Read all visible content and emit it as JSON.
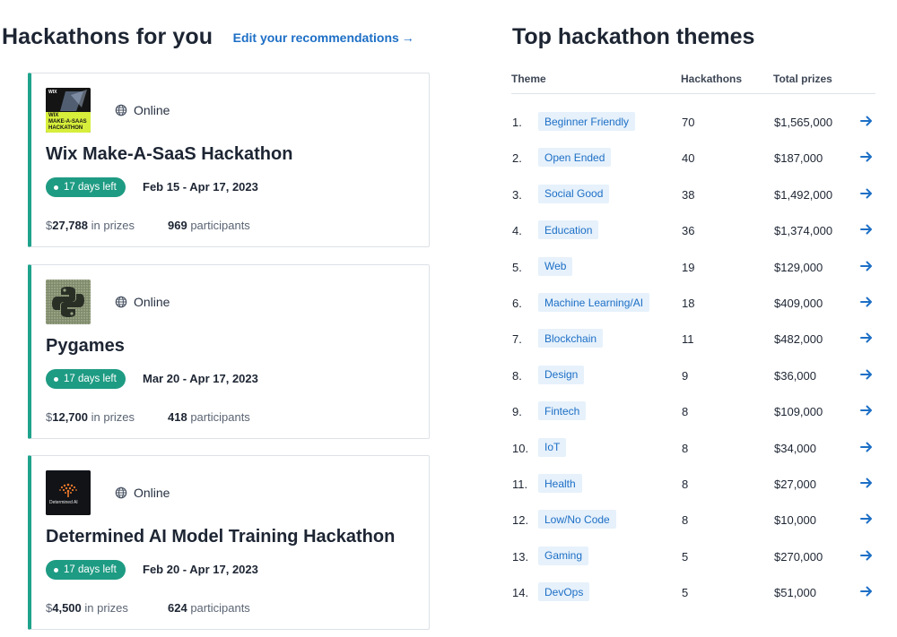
{
  "left": {
    "title": "Hackathons for you",
    "edit_link": "Edit your recommendations"
  },
  "hackathons": [
    {
      "name": "Wix Make-A-SaaS Hackathon",
      "location": "Online",
      "badge": "17 days left",
      "dates": "Feb 15 - Apr 17, 2023",
      "prize_amount": "27,788",
      "prize_suffix": "in prizes",
      "participants": "969",
      "participants_suffix": "participants",
      "thumb_lines": [
        "WIX",
        "MAKE-A-SAAS",
        "HACKATHON"
      ],
      "thumb_brand": "WIX"
    },
    {
      "name": "Pygames",
      "location": "Online",
      "badge": "17 days left",
      "dates": "Mar 20 - Apr 17, 2023",
      "prize_amount": "12,700",
      "prize_suffix": "in prizes",
      "participants": "418",
      "participants_suffix": "participants"
    },
    {
      "name": "Determined AI Model Training Hackathon",
      "location": "Online",
      "badge": "17 days left",
      "dates": "Feb 20 - Apr 17, 2023",
      "prize_amount": "4,500",
      "prize_suffix": "in prizes",
      "participants": "624",
      "participants_suffix": "participants",
      "thumb_text": "Determined AI"
    }
  ],
  "themes": {
    "title": "Top hackathon themes",
    "headers": {
      "theme": "Theme",
      "hackathons": "Hackathons",
      "prizes": "Total prizes"
    },
    "rows": [
      {
        "rank": "1.",
        "theme": "Beginner Friendly",
        "count": "70",
        "prize": "$1,565,000"
      },
      {
        "rank": "2.",
        "theme": "Open Ended",
        "count": "40",
        "prize": "$187,000"
      },
      {
        "rank": "3.",
        "theme": "Social Good",
        "count": "38",
        "prize": "$1,492,000"
      },
      {
        "rank": "4.",
        "theme": "Education",
        "count": "36",
        "prize": "$1,374,000"
      },
      {
        "rank": "5.",
        "theme": "Web",
        "count": "19",
        "prize": "$129,000"
      },
      {
        "rank": "6.",
        "theme": "Machine Learning/AI",
        "count": "18",
        "prize": "$409,000"
      },
      {
        "rank": "7.",
        "theme": "Blockchain",
        "count": "11",
        "prize": "$482,000"
      },
      {
        "rank": "8.",
        "theme": "Design",
        "count": "9",
        "prize": "$36,000"
      },
      {
        "rank": "9.",
        "theme": "Fintech",
        "count": "8",
        "prize": "$109,000"
      },
      {
        "rank": "10.",
        "theme": "IoT",
        "count": "8",
        "prize": "$34,000"
      },
      {
        "rank": "11.",
        "theme": "Health",
        "count": "8",
        "prize": "$27,000"
      },
      {
        "rank": "12.",
        "theme": "Low/No Code",
        "count": "8",
        "prize": "$10,000"
      },
      {
        "rank": "13.",
        "theme": "Gaming",
        "count": "5",
        "prize": "$270,000"
      },
      {
        "rank": "14.",
        "theme": "DevOps",
        "count": "5",
        "prize": "$51,000"
      }
    ]
  },
  "colors": {
    "accent_green": "#1e9b83",
    "link_blue": "#1d6fc6",
    "tag_bg": "#e6f1fb"
  }
}
